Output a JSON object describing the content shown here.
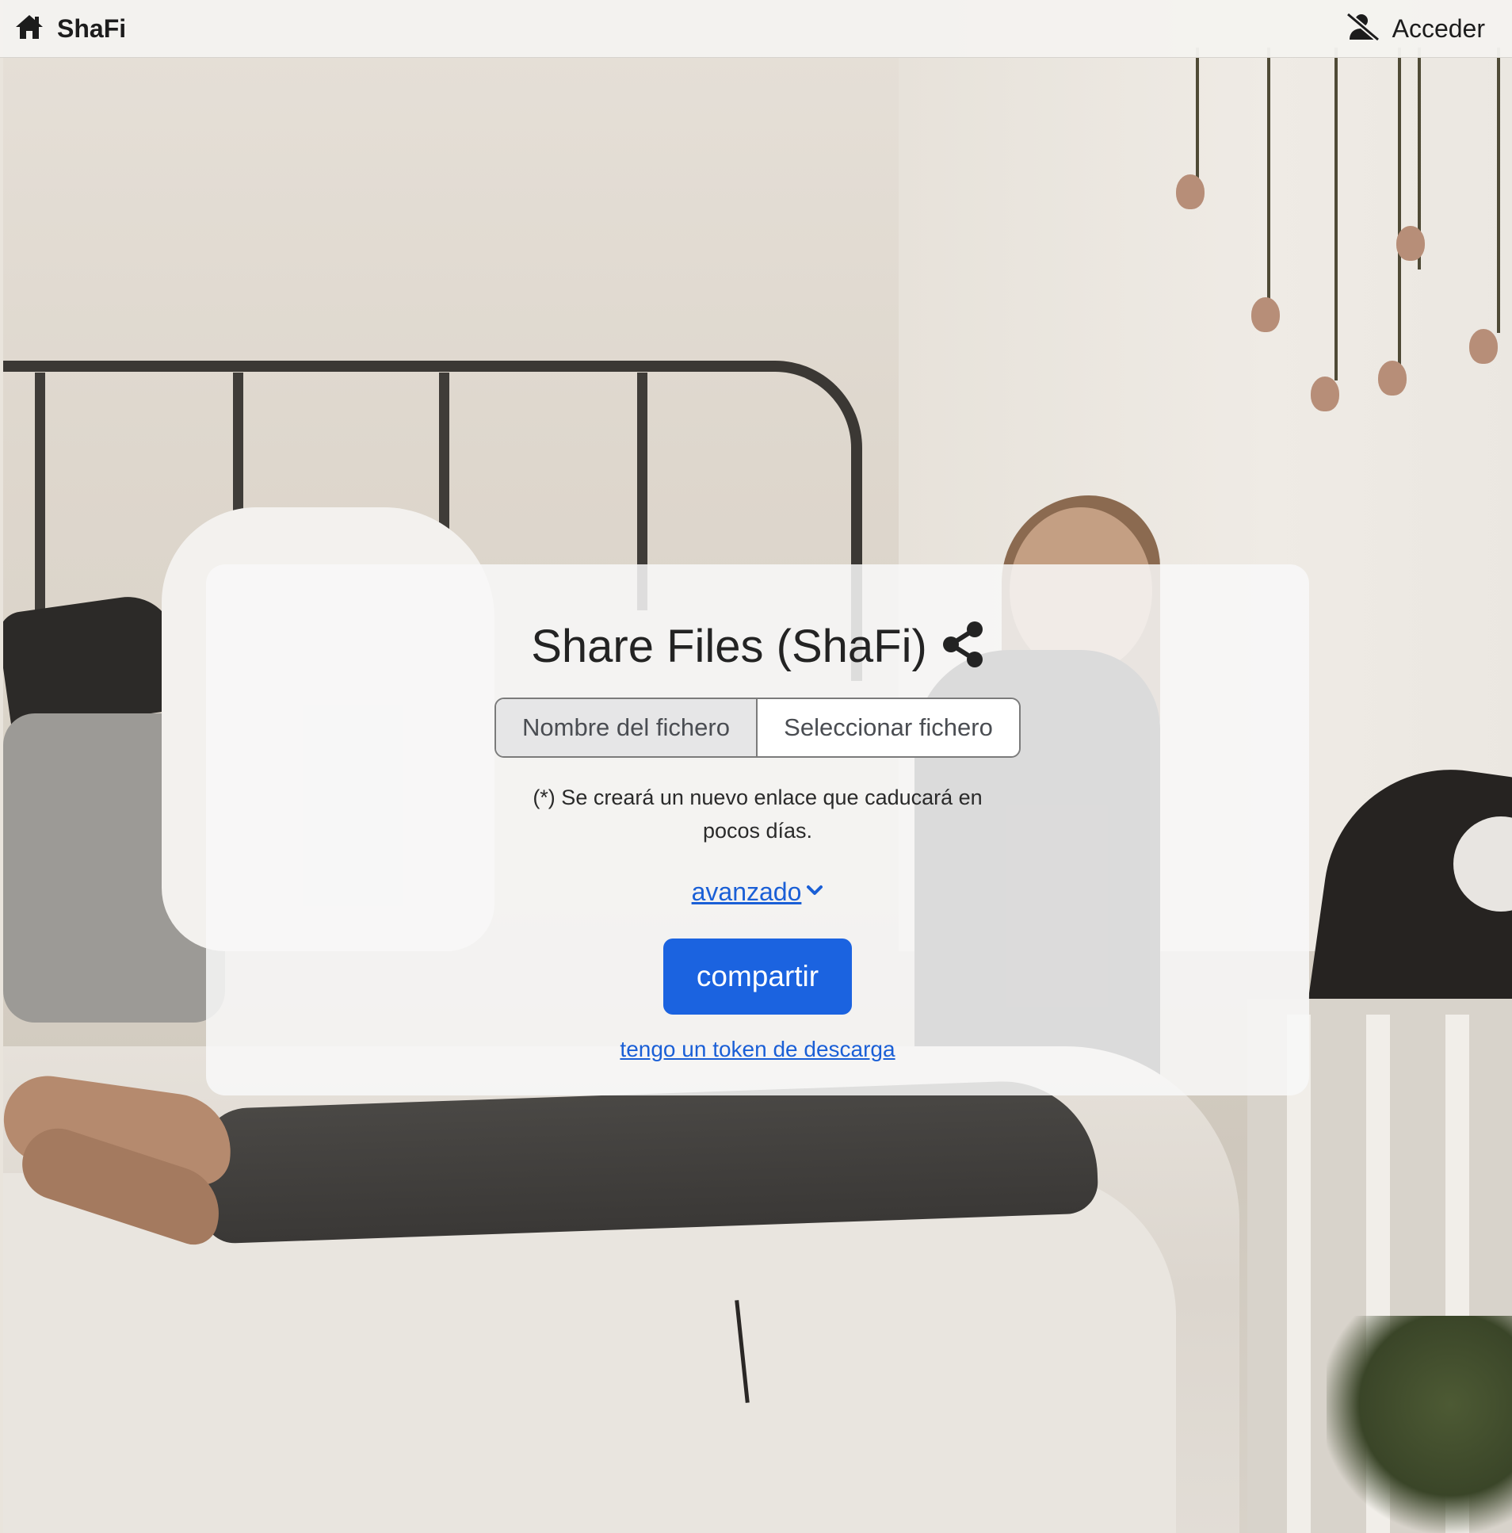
{
  "navbar": {
    "brand": "ShaFi",
    "brand_icon": "home-icon",
    "login_label": "Acceder",
    "login_icon": "user-slash-icon"
  },
  "card": {
    "title": "Share Files (ShaFi)",
    "title_icon": "share-icon",
    "file_name_label": "Nombre del fichero",
    "file_select_label": "Seleccionar fichero",
    "notice": "(*) Se creará un nuevo enlace que caducará en pocos días.",
    "advanced_label": "avanzado",
    "advanced_icon": "chevron-down-icon",
    "share_button": "compartir",
    "token_link": "tengo un token de descarga"
  },
  "colors": {
    "primary": "#1b63e0",
    "link": "#1a5fd6",
    "navbar_bg": "#f4f2ef",
    "card_bg": "#f8f8f8"
  }
}
